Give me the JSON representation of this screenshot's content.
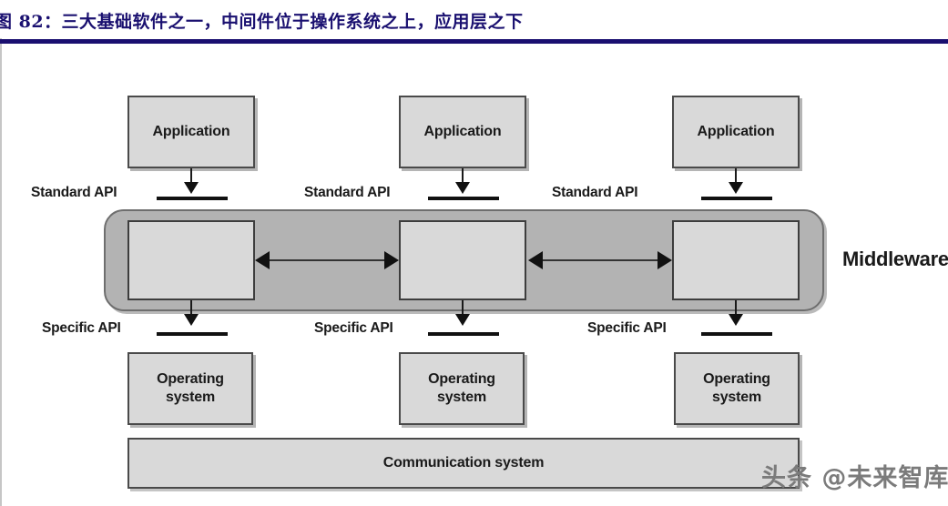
{
  "header": {
    "figure_title": "图 82：三大基础软件之一，中间件位于操作系统之上，应用层之下",
    "rule_color": "#1a0f70",
    "title_color": "#1a1070"
  },
  "diagram": {
    "type": "layered-architecture",
    "columns": [
      {
        "application_label": "Application",
        "standard_api_label": "Standard API",
        "specific_api_label": "Specific API",
        "os_label_line1": "Operating",
        "os_label_line2": "system"
      },
      {
        "application_label": "Application",
        "standard_api_label": "Standard API",
        "specific_api_label": "Specific API",
        "os_label_line1": "Operating",
        "os_label_line2": "system"
      },
      {
        "application_label": "Application",
        "standard_api_label": "Standard API",
        "specific_api_label": "Specific API",
        "os_label_line1": "Operating",
        "os_label_line2": "system"
      }
    ],
    "middleware_label": "Middleware",
    "communication_label": "Communication system",
    "colors": {
      "box_fill": "#d9d9d9",
      "box_border": "#4a4a4a",
      "middleware_fill": "#b3b3b3",
      "middleware_border": "#6e6e6e",
      "connector": "#111111"
    }
  },
  "watermark": {
    "text": "头条 @未来智库"
  }
}
